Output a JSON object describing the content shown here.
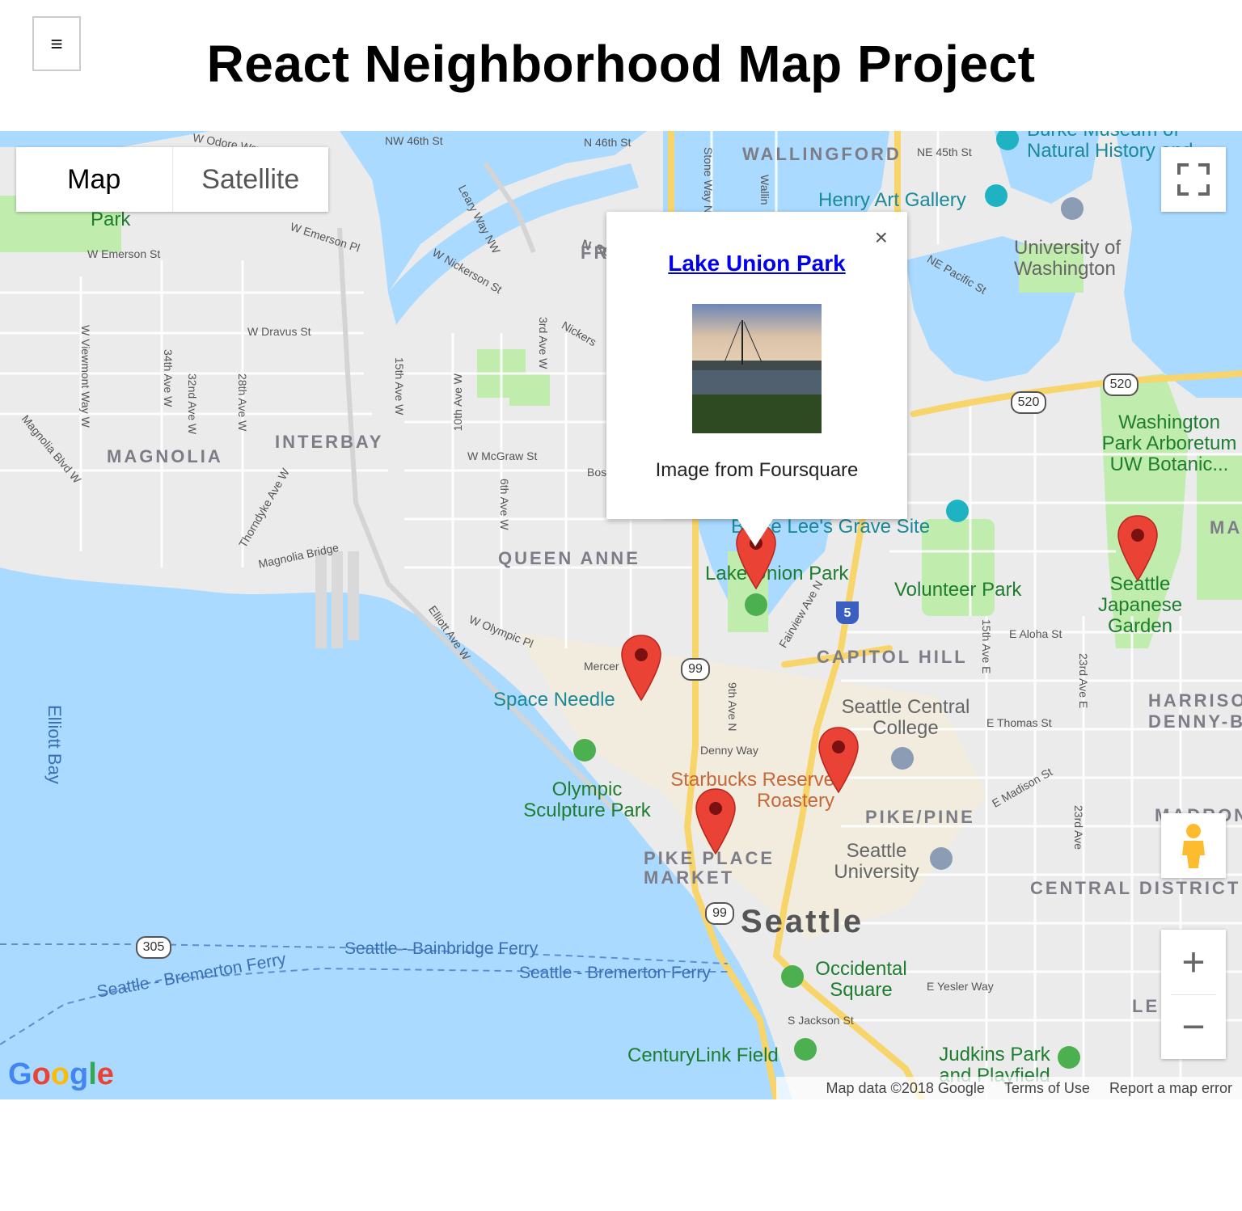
{
  "header": {
    "menu_icon": "hamburger-icon",
    "menu_glyph": "≡",
    "title": "React Neighborhood Map Project"
  },
  "map_type": {
    "map": "Map",
    "satellite": "Satellite",
    "selected": "Map"
  },
  "info_window": {
    "title": "Lake Union Park",
    "close_glyph": "×",
    "caption": "Image from Foursquare"
  },
  "labels": {
    "street": [
      "NW 46th St",
      "N 46th St",
      "NE 45th St",
      "Leary Way NW",
      "W Emerson St",
      "W Emerson Pl",
      "W Nickerson St",
      "N 36th",
      "NE Pacific St",
      "W Dravus St",
      "34th Ave W",
      "32nd Ave W",
      "28th Ave W",
      "W Viewmont Way W",
      "Magnolia Blvd W",
      "15th Ave W",
      "10th Ave W",
      "3rd Ave W",
      "6th Ave W",
      "W McGraw St",
      "Thorndyke Ave W",
      "Magnolia Bridge",
      "Elliott Ave W",
      "W Olympic Pl",
      "Mercer",
      "Denny Way",
      "9th Ave N",
      "Fairview Ave N",
      "15th Ave E",
      "E Aloha St",
      "23rd Ave E",
      "E Thomas St",
      "E Madison St",
      "23rd Ave",
      "E Yesler Way",
      "S Jackson St",
      "Nickers",
      "Bos",
      "W Odore Way",
      "Stone Way N",
      "Wallin"
    ],
    "district": [
      "WALLINGFORD",
      "MAGNOLIA",
      "INTERBAY",
      "QUEEN ANNE",
      "CAPITOL HILL",
      "PIKE/PINE",
      "PIKE PLACE MARKET",
      "CENTRAL DISTRICT",
      "HARRISON DENNY-B",
      "MADRONA",
      "LE",
      "MA",
      "FR"
    ],
    "poi": [
      "Burke Museum of Natural History and",
      "Henry Art Gallery",
      "University of Washington",
      "Washington Park Arboretum UW Botanic...",
      "Bruce Lee's Grave Site",
      "Volunteer Park",
      "Seattle Japanese Garden",
      "Lake Union Park",
      "Space Needle",
      "Olympic Sculpture Park",
      "Starbucks Reserve Roastery",
      "Seattle Central College",
      "Seattle University",
      "Occidental Square",
      "CenturyLink Field",
      "Judkins Park and Playfield",
      "Park",
      "Elliott Bay",
      "Seattle - Bainbridge Ferry",
      "Seattle - Bremerton Ferry"
    ],
    "city": "Seattle",
    "highways": [
      "520",
      "520",
      "99",
      "99",
      "305",
      "5"
    ]
  },
  "markers": [
    "Seattle Japanese Garden",
    "Lake Union Park",
    "Space Needle",
    "Starbucks Reserve Roastery",
    "Pike Place Market"
  ],
  "controls": {
    "fullscreen_icon": "fullscreen-icon",
    "pegman_icon": "pegman-icon",
    "zoom_in": "+",
    "zoom_out": "−"
  },
  "attribution": {
    "logo": "Google",
    "map_data": "Map data ©2018 Google",
    "terms": "Terms of Use",
    "report": "Report a map error"
  },
  "colors": {
    "water": "#aadaff",
    "park": "#c0ecae",
    "highway": "#f8d56a",
    "marker": "#ea4335"
  }
}
